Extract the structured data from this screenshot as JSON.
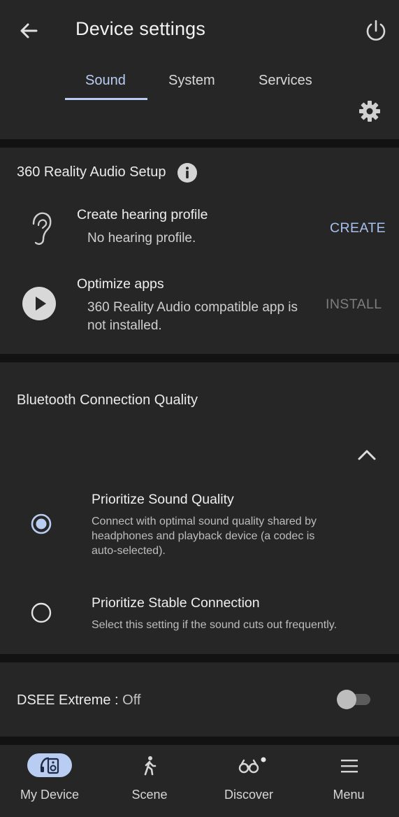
{
  "header": {
    "title": "Device settings"
  },
  "tabs": [
    {
      "label": "Sound",
      "active": true
    },
    {
      "label": "System",
      "active": false
    },
    {
      "label": "Services",
      "active": false
    }
  ],
  "reality_audio": {
    "title": "360 Reality Audio Setup",
    "hearing_profile": {
      "title": "Create hearing profile",
      "subtitle": "No hearing profile.",
      "action": "CREATE"
    },
    "optimize_apps": {
      "title": "Optimize apps",
      "subtitle_line1": "360 Reality Audio compatible app is",
      "subtitle_line2": "not installed.",
      "action": "INSTALL"
    }
  },
  "bluetooth": {
    "title": "Bluetooth Connection Quality",
    "options": [
      {
        "title": "Prioritize Sound Quality",
        "desc_line1": "Connect with optimal sound quality shared by",
        "desc_line2": "headphones and playback device (a codec is",
        "desc_line3": "auto-selected).",
        "selected": true
      },
      {
        "title": "Prioritize Stable Connection",
        "desc_line1": "Select this setting if the sound cuts out frequently.",
        "selected": false
      }
    ]
  },
  "dsee": {
    "label": "DSEE Extreme : ",
    "value": "Off",
    "enabled": false
  },
  "bottom_nav": [
    {
      "label": "My Device",
      "icon": "headphones-device-icon",
      "active": true
    },
    {
      "label": "Scene",
      "icon": "walking-person-icon",
      "active": false
    },
    {
      "label": "Discover",
      "icon": "binoculars-icon",
      "active": false
    },
    {
      "label": "Menu",
      "icon": "hamburger-menu-icon",
      "active": false
    }
  ],
  "colors": {
    "accent": "#b9cdf2",
    "surface": "#262626",
    "background": "#121212",
    "disabled": "#7d7d7d"
  }
}
